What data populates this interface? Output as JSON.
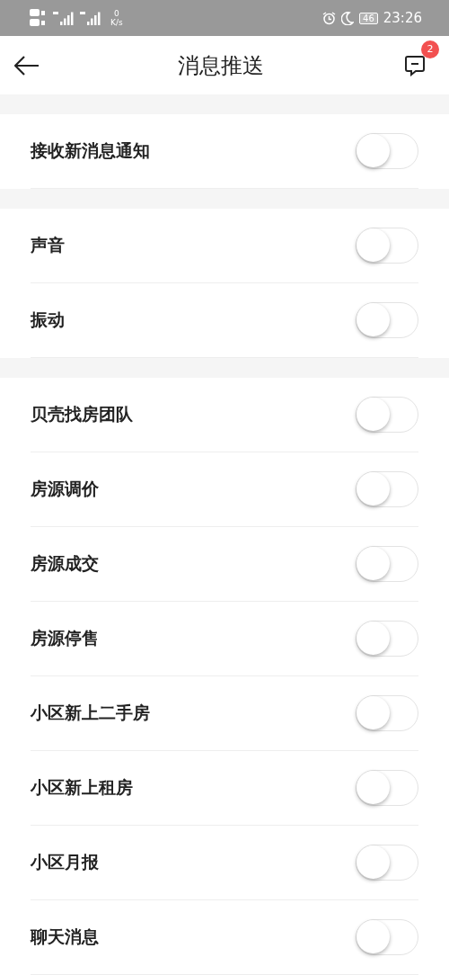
{
  "status_bar": {
    "speed_value": "0",
    "speed_unit": "K/s",
    "battery": "46",
    "time": "23:26"
  },
  "header": {
    "title": "消息推送",
    "badge": "2"
  },
  "sections": [
    {
      "items": [
        {
          "label": "接收新消息通知",
          "on": false
        }
      ]
    },
    {
      "items": [
        {
          "label": "声音",
          "on": false
        },
        {
          "label": "振动",
          "on": false
        }
      ]
    },
    {
      "items": [
        {
          "label": "贝壳找房团队",
          "on": false
        },
        {
          "label": "房源调价",
          "on": false
        },
        {
          "label": "房源成交",
          "on": false
        },
        {
          "label": "房源停售",
          "on": false
        },
        {
          "label": "小区新上二手房",
          "on": false
        },
        {
          "label": "小区新上租房",
          "on": false
        },
        {
          "label": "小区月报",
          "on": false
        },
        {
          "label": "聊天消息",
          "on": false
        }
      ]
    }
  ]
}
